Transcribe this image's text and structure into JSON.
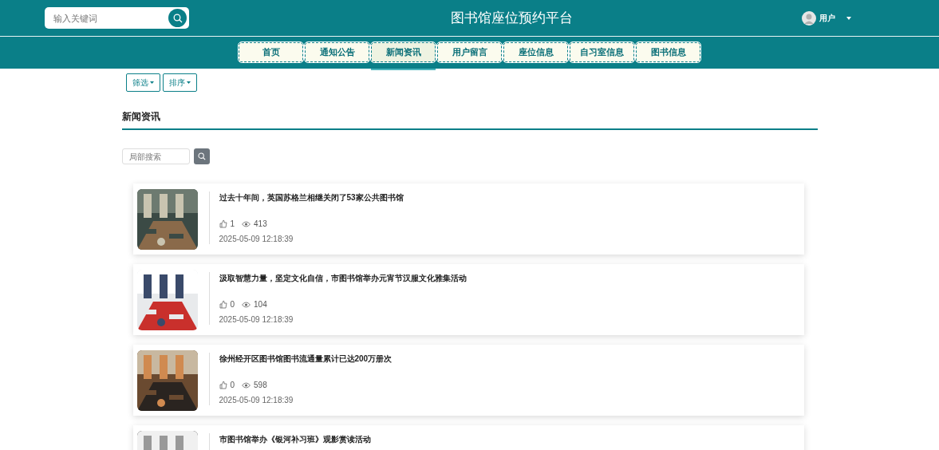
{
  "header": {
    "search": {
      "placeholder": "输入关键词"
    },
    "title": "图书馆座位预约平台",
    "user": {
      "name": "用户"
    }
  },
  "nav": [
    {
      "label": "首页",
      "selected": false
    },
    {
      "label": "通知公告",
      "selected": false
    },
    {
      "label": "新闻资讯",
      "selected": true
    },
    {
      "label": "用户留言",
      "selected": false
    },
    {
      "label": "座位信息",
      "selected": false
    },
    {
      "label": "自习室信息",
      "selected": false
    },
    {
      "label": "图书信息",
      "selected": false
    }
  ],
  "filters": [
    "筛选",
    "排序"
  ],
  "section_title": "新闻资讯",
  "local_search": {
    "placeholder": "局部搜索"
  },
  "news": [
    {
      "title": "过去十年间，英国苏格兰相继关闭了53家公共图书馆",
      "likes": "1",
      "views": "413",
      "date": "2025-05-09 12:18:39"
    },
    {
      "title": "汲取智慧力量，坚定文化自信，市图书馆举办元宵节汉服文化雅集活动",
      "likes": "0",
      "views": "104",
      "date": "2025-05-09 12:18:39"
    },
    {
      "title": "徐州经开区图书馆图书流通量累计已达200万册次",
      "likes": "0",
      "views": "598",
      "date": "2025-05-09 12:18:39"
    },
    {
      "title": "市图书馆举办《银河补习班》观影赏读活动"
    }
  ]
}
